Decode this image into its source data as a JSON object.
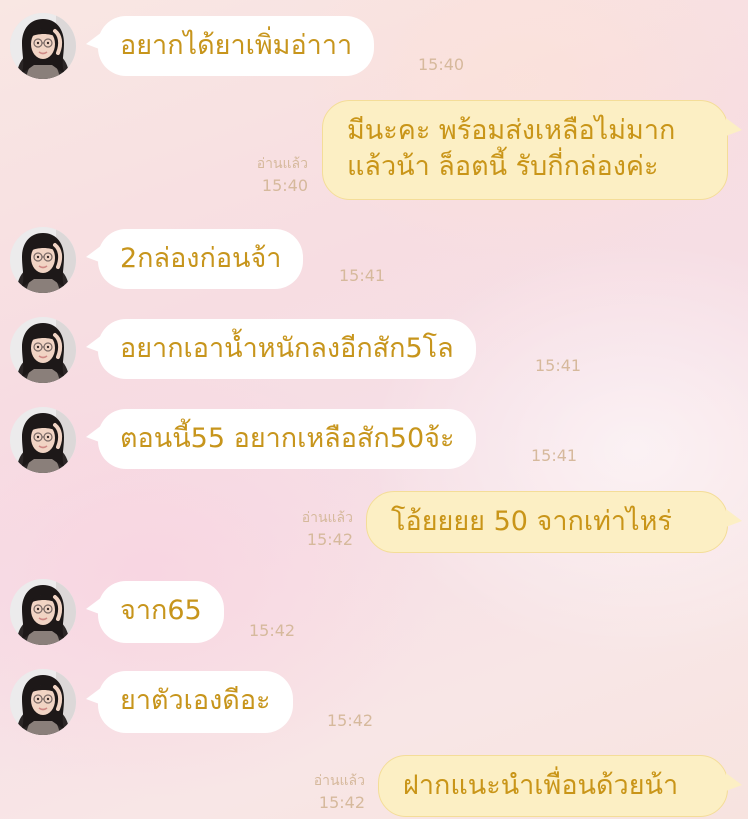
{
  "messages": [
    {
      "text": "อยากได้ยาเพิ่มอ่าาา",
      "time": "15:40"
    },
    {
      "line1": "มีนะคะ พร้อมส่งเหลือไม่มาก",
      "line2": "แล้วน้า ล็อตนี้ รับกี่กล่องค่ะ",
      "status": "อ่านแล้ว",
      "time": "15:40"
    },
    {
      "text": "2กล่องก่อนจ้า",
      "time": "15:41"
    },
    {
      "text": "อยากเอาน้ำหนักลงอีกสัก5โล",
      "time": "15:41"
    },
    {
      "text": "ตอนนี้55 อยากเหลือสัก50จ้ะ",
      "time": "15:41"
    },
    {
      "text": "โอ้ยยยย 50 จากเท่าไหร่",
      "status": "อ่านแล้ว",
      "time": "15:42"
    },
    {
      "text": "จาก65",
      "time": "15:42"
    },
    {
      "text": "ยาตัวเองดีอะ",
      "time": "15:42"
    },
    {
      "text": "ฝากแนะนำเพื่อนด้วยน้า",
      "status": "อ่านแล้ว",
      "time": "15:42"
    }
  ],
  "colors": {
    "incoming_bubble": "#ffffff",
    "outgoing_bubble": "#fcefc4",
    "message_text": "#c7951c",
    "meta_text": "#d6b99c"
  }
}
